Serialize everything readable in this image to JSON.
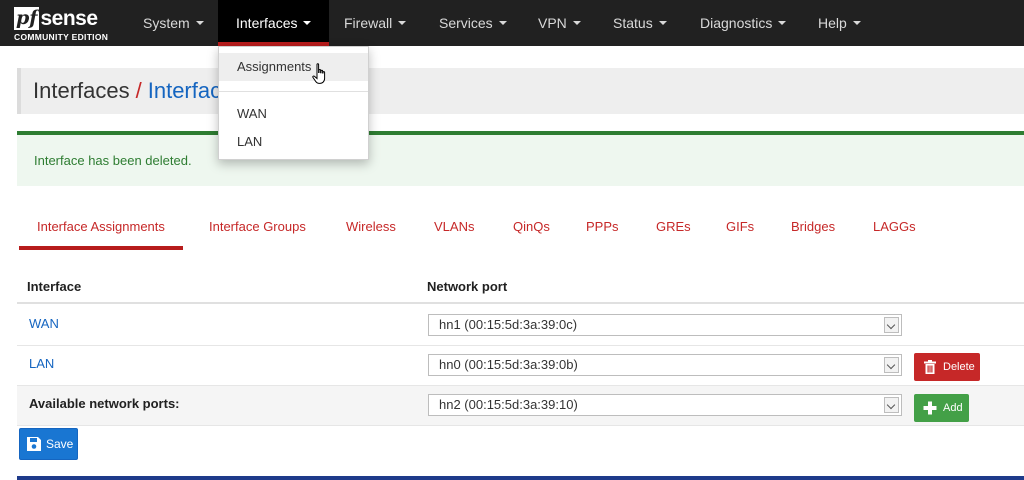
{
  "logo": {
    "brand_pf": "pf",
    "brand_sense": "sense",
    "edition": "COMMUNITY EDITION"
  },
  "nav": {
    "items": [
      {
        "label": "System"
      },
      {
        "label": "Interfaces"
      },
      {
        "label": "Firewall"
      },
      {
        "label": "Services"
      },
      {
        "label": "VPN"
      },
      {
        "label": "Status"
      },
      {
        "label": "Diagnostics"
      },
      {
        "label": "Help"
      }
    ],
    "active": "Interfaces"
  },
  "dropdown": {
    "items": [
      {
        "label": "Assignments"
      },
      {
        "label": "WAN"
      },
      {
        "label": "LAN"
      }
    ]
  },
  "breadcrumb": {
    "root": "Interfaces",
    "separator": "/",
    "leaf": "Interfac"
  },
  "alert": {
    "message": "Interface has been deleted."
  },
  "tabs": [
    {
      "label": "Interface Assignments"
    },
    {
      "label": "Interface Groups"
    },
    {
      "label": "Wireless"
    },
    {
      "label": "VLANs"
    },
    {
      "label": "QinQs"
    },
    {
      "label": "PPPs"
    },
    {
      "label": "GREs"
    },
    {
      "label": "GIFs"
    },
    {
      "label": "Bridges"
    },
    {
      "label": "LAGGs"
    }
  ],
  "table": {
    "headers": {
      "interface": "Interface",
      "network_port": "Network port"
    },
    "rows": [
      {
        "interface": "WAN",
        "port": "hn1 (00:15:5d:3a:39:0c)"
      },
      {
        "interface": "LAN",
        "port": "hn0 (00:15:5d:3a:39:0b)",
        "action": "Delete"
      },
      {
        "interface": "Available network ports:",
        "port": "hn2 (00:15:5d:3a:39:10)",
        "action": "Add"
      }
    ]
  },
  "buttons": {
    "save": "Save"
  },
  "colors": {
    "navbar": "#212121",
    "accent_red": "#b71c1c",
    "link_blue": "#1565c0",
    "success_green": "#2e7d32",
    "save_blue": "#1976d2",
    "add_green": "#43a047"
  }
}
